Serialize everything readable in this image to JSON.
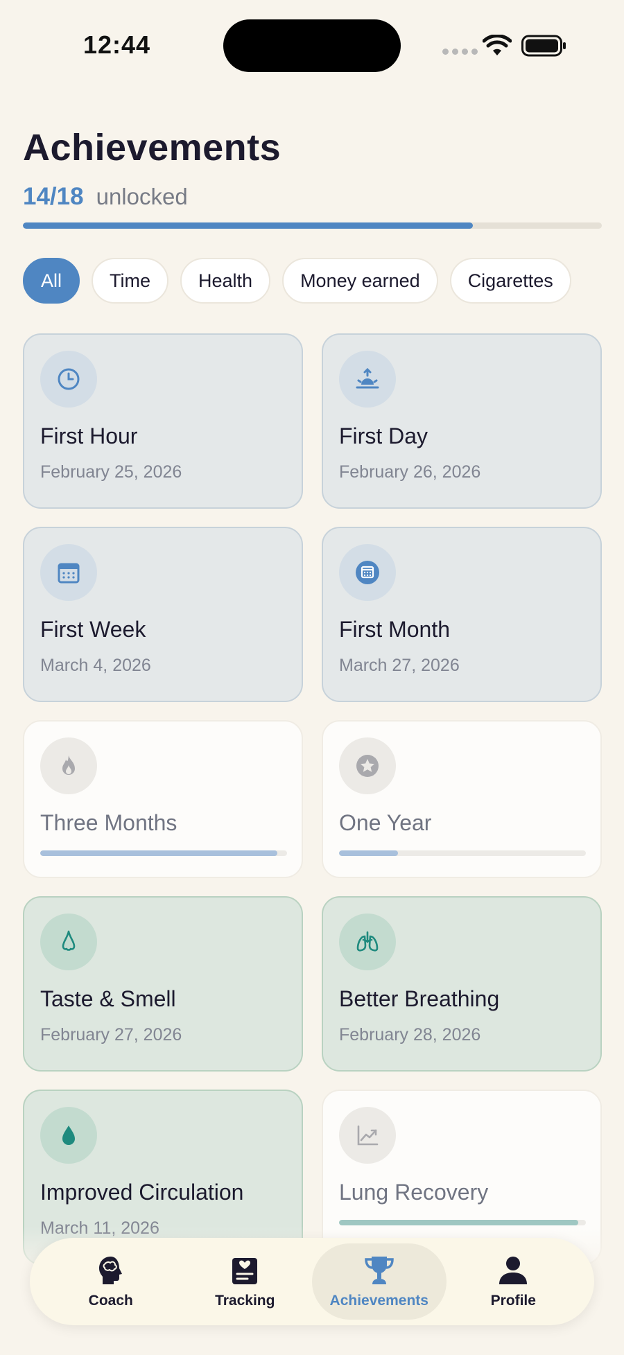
{
  "status": {
    "time": "12:44"
  },
  "header": {
    "title": "Achievements",
    "unlocked_count": "14/18",
    "unlocked_label": "unlocked",
    "progress": 0.7778
  },
  "filters": [
    {
      "label": "All",
      "active": true
    },
    {
      "label": "Time",
      "active": false
    },
    {
      "label": "Health",
      "active": false
    },
    {
      "label": "Money earned",
      "active": false
    },
    {
      "label": "Cigarettes",
      "active": false
    }
  ],
  "achievements": [
    {
      "title": "First Hour",
      "date": "February 25, 2026",
      "icon": "clock-icon",
      "state": "unlocked"
    },
    {
      "title": "First Day",
      "date": "February 26, 2026",
      "icon": "sunrise-icon",
      "state": "unlocked"
    },
    {
      "title": "First Week",
      "date": "March 4, 2026",
      "icon": "calendar-icon",
      "state": "unlocked"
    },
    {
      "title": "First Month",
      "date": "March 27, 2026",
      "icon": "calendar-badge-icon",
      "state": "unlocked"
    },
    {
      "title": "Three Months",
      "progress": 0.96,
      "icon": "flame-icon",
      "state": "locked"
    },
    {
      "title": "One Year",
      "progress": 0.24,
      "icon": "star-icon",
      "state": "locked"
    },
    {
      "title": "Taste & Smell",
      "date": "February 27, 2026",
      "icon": "nose-icon",
      "state": "health"
    },
    {
      "title": "Better Breathing",
      "date": "February 28, 2026",
      "icon": "lungs-icon",
      "state": "health"
    },
    {
      "title": "Improved Circulation",
      "date": "March 11, 2026",
      "icon": "drop-icon",
      "state": "health"
    },
    {
      "title": "Lung Recovery",
      "progress": 0.97,
      "icon": "chart-icon",
      "state": "locked"
    }
  ],
  "nav": [
    {
      "label": "Coach",
      "icon": "brain-head-icon",
      "active": false
    },
    {
      "label": "Tracking",
      "icon": "journal-icon",
      "active": false
    },
    {
      "label": "Achievements",
      "icon": "trophy-icon",
      "active": true
    },
    {
      "label": "Profile",
      "icon": "person-icon",
      "active": false
    }
  ],
  "colors": {
    "accent": "#4f86c2",
    "background": "#f8f4ec",
    "health_card": "#dde7df",
    "teal": "#1e8a7e"
  }
}
